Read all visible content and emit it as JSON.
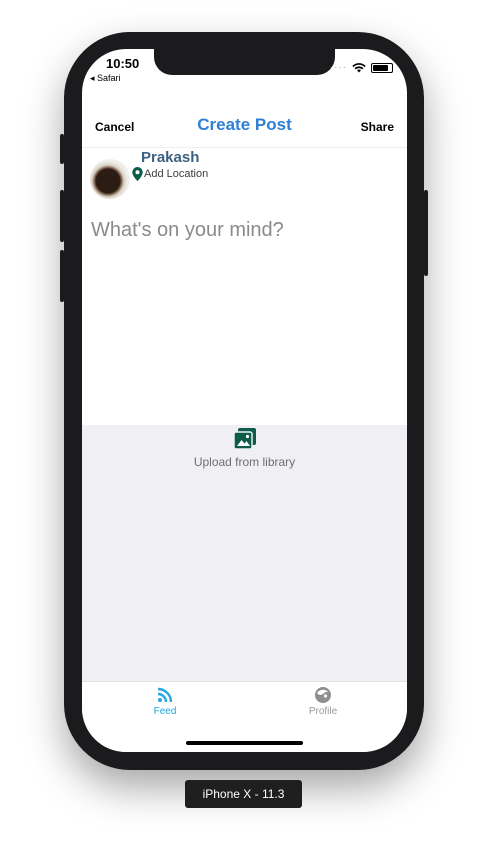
{
  "status_bar": {
    "time": "10:50",
    "back_app": "◂ Safari"
  },
  "nav": {
    "cancel": "Cancel",
    "title": "Create Post",
    "share": "Share"
  },
  "user": {
    "name": "Prakash",
    "add_location": "Add Location"
  },
  "post": {
    "placeholder": "What's on your mind?",
    "value": ""
  },
  "library": {
    "upload_label": "Upload from library",
    "icon": "gallery-icon"
  },
  "tabs": [
    {
      "label": "Feed",
      "icon": "rss-icon",
      "active": true
    },
    {
      "label": "Profile",
      "icon": "profile-face-icon",
      "active": false
    }
  ],
  "device_label": "iPhone X - 11.3",
  "colors": {
    "accent_blue": "#2f7fd6",
    "tab_active": "#25a8e0",
    "pin_green": "#0d5c4a",
    "panel_bg": "#efeff4"
  }
}
